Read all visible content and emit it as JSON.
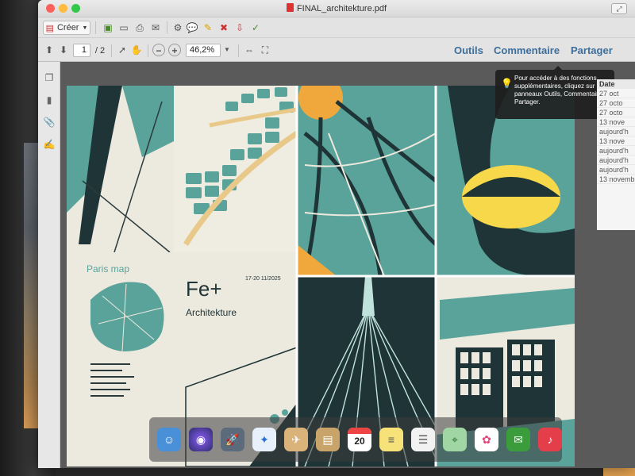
{
  "window": {
    "title": "FINAL_architekture.pdf"
  },
  "toolbar": {
    "create_label": "Créer",
    "page_current": "1",
    "page_total": "/ 2",
    "zoom": "46,2%"
  },
  "panels": {
    "tools": "Outils",
    "comment": "Commentaire",
    "share": "Partager"
  },
  "tooltip": {
    "text": "Pour accéder à des fonctions supplémentaires, cliquez sur les panneaux Outils, Commentaire et Partager."
  },
  "poster": {
    "paris_map_title": "Paris map",
    "brand": "Fe+",
    "subtitle": "Architekture",
    "dates": "17-20 11/2025"
  },
  "background_window": {
    "date_header": "Date",
    "dates": [
      "27 oct",
      "27 octo",
      "27 octo",
      "13 nove",
      "aujourd'h",
      "13 nove",
      "aujourd'h",
      "aujourd'h",
      "aujourd'h",
      "13 novemb"
    ]
  },
  "dock": {
    "calendar_day": "20"
  },
  "colors": {
    "teal": "#5aa39b",
    "navy": "#1f3436",
    "orange": "#f0a83c",
    "yellow": "#f6d84a",
    "panel_link": "#3c6e9c"
  }
}
